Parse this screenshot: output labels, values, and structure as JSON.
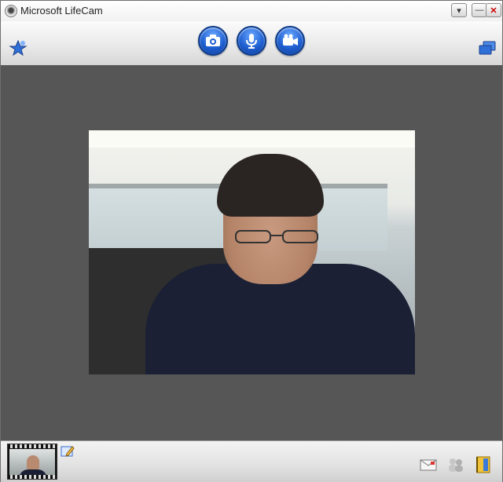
{
  "window": {
    "title": "Microsoft LifeCam",
    "buttons": [
      "dropdown",
      "minimize",
      "close"
    ]
  },
  "toolbar": {
    "icons": {
      "left": "pin-star-icon",
      "photo": "camera-icon",
      "audio": "microphone-icon",
      "video": "video-camera-icon",
      "right": "windows-icon"
    }
  },
  "bottombar": {
    "icons": [
      "mail-icon",
      "people-icon",
      "album-icon"
    ]
  },
  "colors": {
    "accent": "#1f5fd0",
    "viewport": "#565656"
  }
}
